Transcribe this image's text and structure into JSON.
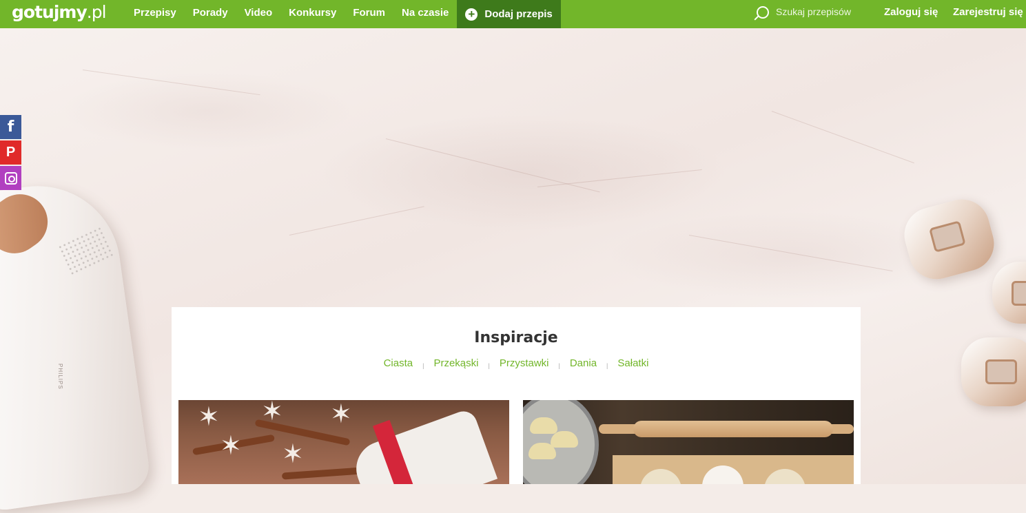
{
  "header": {
    "logo_main": "gotujmy",
    "logo_suffix": ".pl",
    "nav": [
      "Przepisy",
      "Porady",
      "Video",
      "Konkursy",
      "Forum",
      "Na czasie"
    ],
    "add_recipe": "Dodaj przepis",
    "search_placeholder": "Szukaj przepisów",
    "login": "Zaloguj się",
    "register": "Zarejestruj się",
    "brand_color": "#72b62a",
    "add_button_color": "#3e7a1b"
  },
  "social": {
    "facebook": {
      "icon": "facebook-icon",
      "glyph": "f",
      "color": "#3b5998"
    },
    "pinterest": {
      "icon": "pinterest-icon",
      "glyph": "P",
      "color": "#e02a2a"
    },
    "instagram": {
      "icon": "instagram-icon",
      "color": "#b13fc0"
    }
  },
  "ad": {
    "brand_text": "PHILIPS"
  },
  "inspiration": {
    "title": "Inspiracje",
    "categories": [
      "Ciasta",
      "Przekąski",
      "Przystawki",
      "Dania",
      "Sałatki"
    ],
    "separator": "|"
  }
}
